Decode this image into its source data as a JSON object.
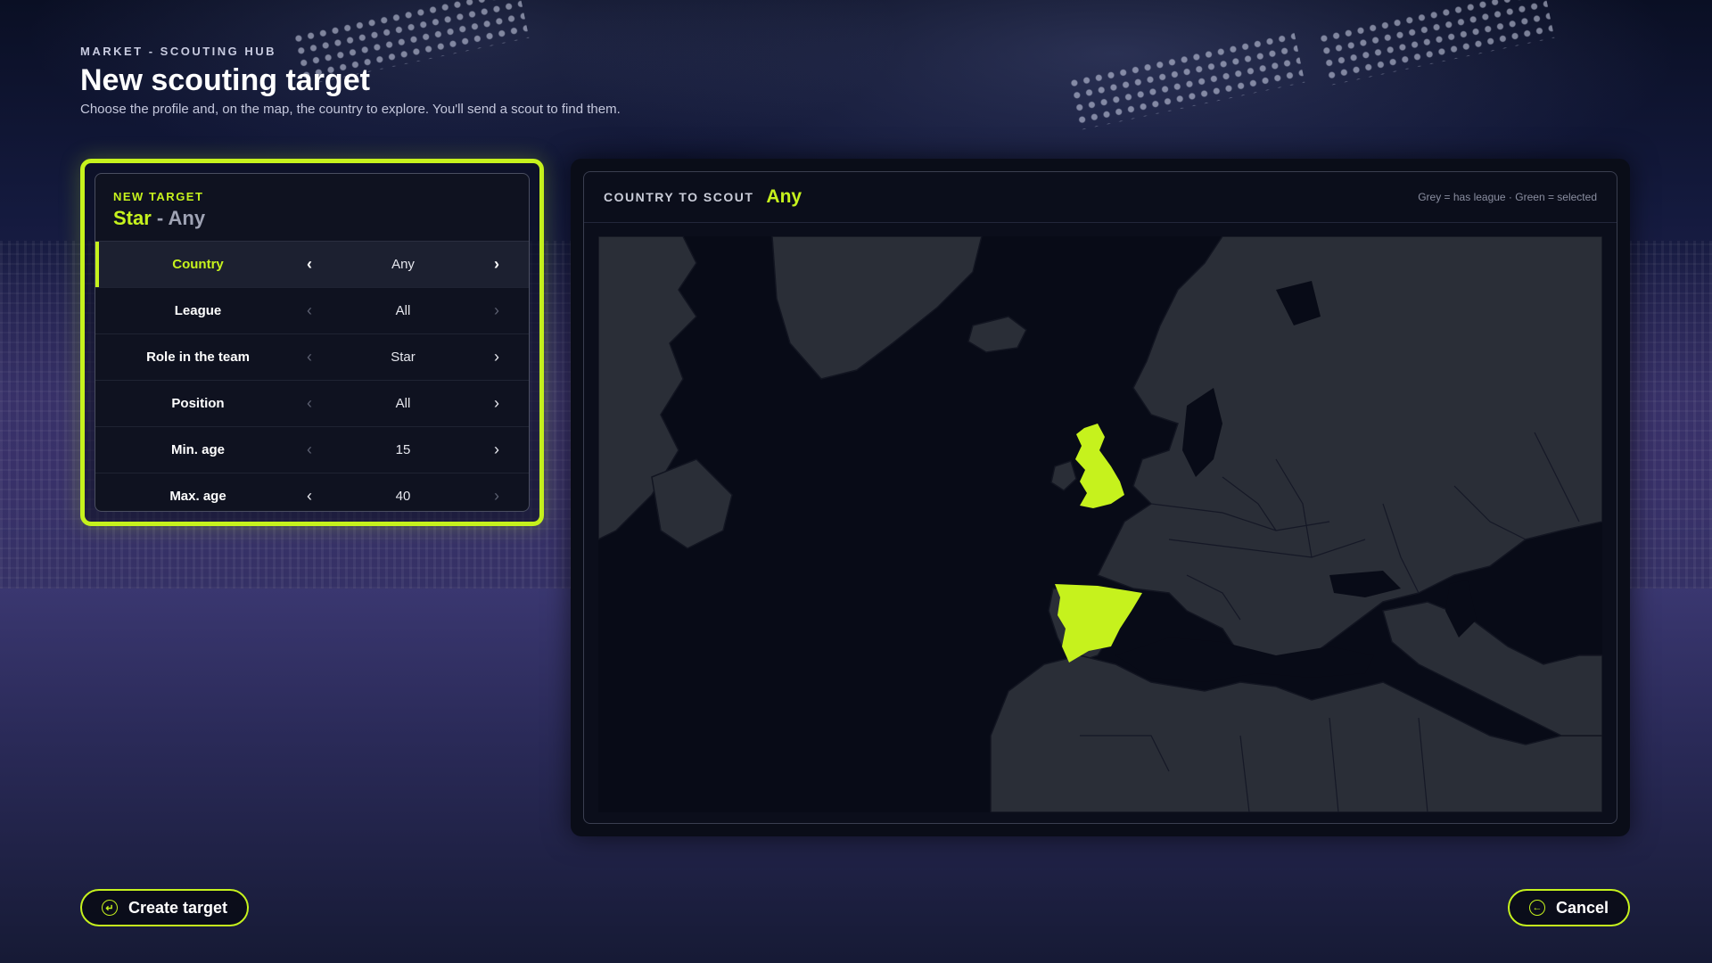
{
  "header": {
    "eyebrow": "MARKET - SCOUTING HUB",
    "title": "New scouting target",
    "subtitle": "Choose the profile and, on the map, the country to explore. You'll send a scout to find them."
  },
  "form": {
    "eyebrow": "NEW TARGET",
    "title_accent": "Star",
    "title_rest": " - Any",
    "rows": [
      {
        "label": "Country",
        "value": "Any",
        "prev_icon": "‹",
        "next_icon": "›"
      },
      {
        "label": "League",
        "value": "All",
        "prev_icon": "‹",
        "next_icon": "›"
      },
      {
        "label": "Role in the team",
        "value": "Star",
        "prev_icon": "‹",
        "next_icon": "›"
      },
      {
        "label": "Position",
        "value": "All",
        "prev_icon": "‹",
        "next_icon": "›"
      },
      {
        "label": "Min. age",
        "value": "15",
        "prev_icon": "‹",
        "next_icon": "›"
      },
      {
        "label": "Max. age",
        "value": "40",
        "prev_icon": "‹",
        "next_icon": "›"
      }
    ]
  },
  "map": {
    "label": "COUNTRY TO SCOUT",
    "value": "Any",
    "legend": "Grey = has league · Green = selected",
    "highlighted_countries": [
      "United Kingdom",
      "Spain"
    ]
  },
  "actions": {
    "create_label": "Create target",
    "create_icon": "↵",
    "cancel_label": "Cancel",
    "cancel_icon": "←"
  },
  "colors": {
    "accent": "#c6f21d",
    "land": "#2a2e37",
    "sea": "#080b17"
  }
}
